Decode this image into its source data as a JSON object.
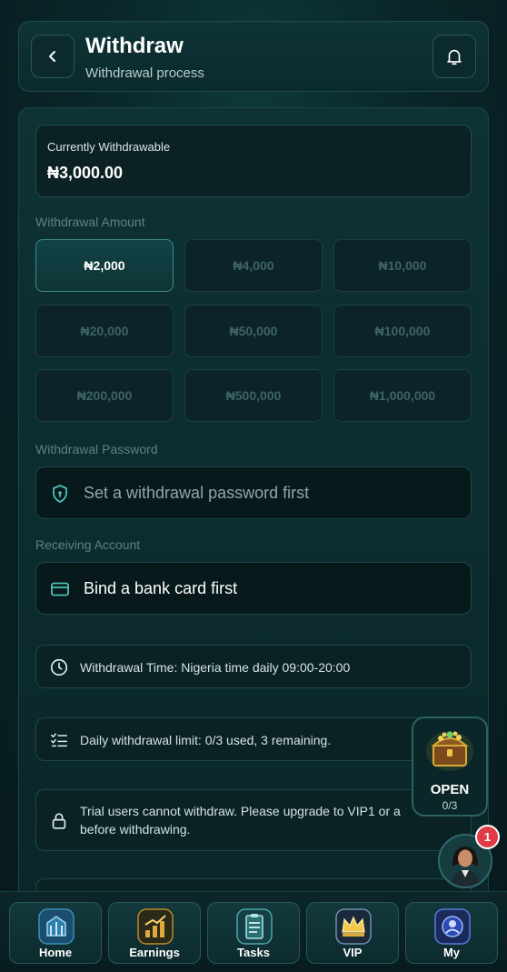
{
  "header": {
    "title": "Withdraw",
    "subtitle": "Withdrawal process"
  },
  "balance": {
    "label": "Currently Withdrawable",
    "value": "₦3,000.00"
  },
  "amount_section": {
    "label": "Withdrawal Amount",
    "options": [
      "₦2,000",
      "₦4,000",
      "₦10,000",
      "₦20,000",
      "₦50,000",
      "₦100,000",
      "₦200,000",
      "₦500,000",
      "₦1,000,000"
    ],
    "selected": "₦2,000"
  },
  "password_section": {
    "label": "Withdrawal Password",
    "placeholder": "Set a withdrawal password first"
  },
  "account_section": {
    "label": "Receiving Account",
    "value": "Bind a bank card first"
  },
  "info": {
    "time": "Withdrawal Time: Nigeria time daily 09:00-20:00",
    "limit": "Daily withdrawal limit: 0/3 used, 3 remaining.",
    "trial_line1": "Trial users cannot withdraw. Please upgrade to VIP1 or a",
    "trial_line2": "before withdrawing."
  },
  "chest": {
    "label": "OPEN",
    "count": "0/3"
  },
  "notification_badge": "1",
  "tabs": [
    {
      "label": "Home",
      "icon": "home-building-icon"
    },
    {
      "label": "Earnings",
      "icon": "earnings-chart-icon"
    },
    {
      "label": "Tasks",
      "icon": "tasks-clipboard-icon"
    },
    {
      "label": "VIP",
      "icon": "vip-crown-icon"
    },
    {
      "label": "My",
      "icon": "my-profile-icon"
    }
  ],
  "colors": {
    "accent": "#3a8a8c",
    "background": "#0a2629",
    "badge": "#e03a44"
  }
}
